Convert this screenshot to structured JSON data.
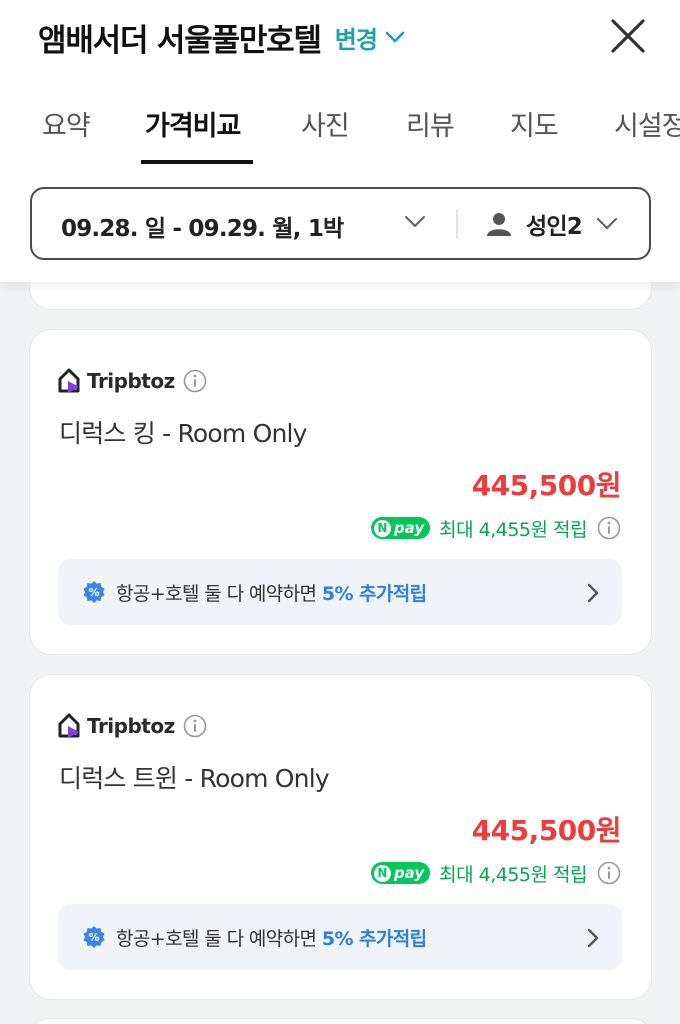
{
  "header": {
    "hotel_name": "앰배서더 서울풀만호텔",
    "change_label": "변경"
  },
  "tabs": [
    {
      "label": "요약",
      "active": false
    },
    {
      "label": "가격비교",
      "active": true
    },
    {
      "label": "사진",
      "active": false
    },
    {
      "label": "리뷰",
      "active": false
    },
    {
      "label": "지도",
      "active": false
    },
    {
      "label": "시설정",
      "active": false
    }
  ],
  "search": {
    "dates": "09.28. 일 - 09.29. 월, 1박",
    "guests": "성인2"
  },
  "offers": [
    {
      "provider": "Tripbtoz",
      "room": "디럭스 킹 - Room Only",
      "price": "445,500원",
      "npay_label": "pay",
      "npay_text": "최대 4,455원 적립",
      "promo_text": "항공+호텔 둘 다 예약하면 ",
      "promo_highlight": "5% 추가적립"
    },
    {
      "provider": "Tripbtoz",
      "room": "디럭스 트윈 - Room Only",
      "price": "445,500원",
      "npay_label": "pay",
      "npay_text": "최대 4,455원 적립",
      "promo_text": "항공+호텔 둘 다 예약하면 ",
      "promo_highlight": "5% 추가적립"
    }
  ],
  "colors": {
    "accent_teal": "#1aa3a8",
    "price_red": "#ee3b3b",
    "npay_green": "#03c75a",
    "promo_blue": "#2d7fe0"
  },
  "icons": [
    "chevron-down-icon",
    "close-icon",
    "person-icon",
    "tripbtoz-logo-icon",
    "info-icon",
    "percent-badge-icon",
    "chevron-right-icon"
  ]
}
